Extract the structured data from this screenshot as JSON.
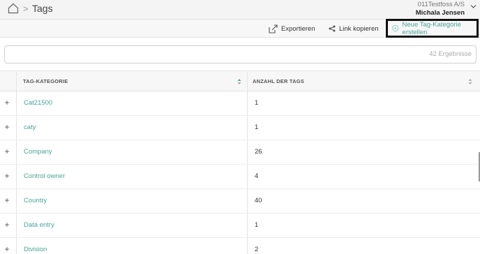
{
  "header": {
    "title": "Tags",
    "breadcrumb_sep": ">",
    "account": {
      "company": "011Testfoss A/S",
      "user": "Michala Jensen"
    }
  },
  "actions": {
    "export": "Exportieren",
    "copy_link": "Link kopieren",
    "new_category": "Neue Tag-Kategorie erstellen"
  },
  "search": {
    "value": "",
    "placeholder": "",
    "result_count": "42 Ergebnisse"
  },
  "table": {
    "columns": [
      "TAG-KATEGORIE",
      "ANZAHL DER TAGS"
    ],
    "rows": [
      {
        "category": "Cat21500",
        "count": "1"
      },
      {
        "category": "caty",
        "count": "1"
      },
      {
        "category": "Company",
        "count": "26"
      },
      {
        "category": "Control owner",
        "count": "4"
      },
      {
        "category": "Country",
        "count": "40"
      },
      {
        "category": "Data entry",
        "count": "1"
      },
      {
        "category": "Division",
        "count": "2"
      }
    ],
    "expand_glyph": "+"
  },
  "colors": {
    "accent": "#4aa39a",
    "highlight_border": "#111111"
  }
}
